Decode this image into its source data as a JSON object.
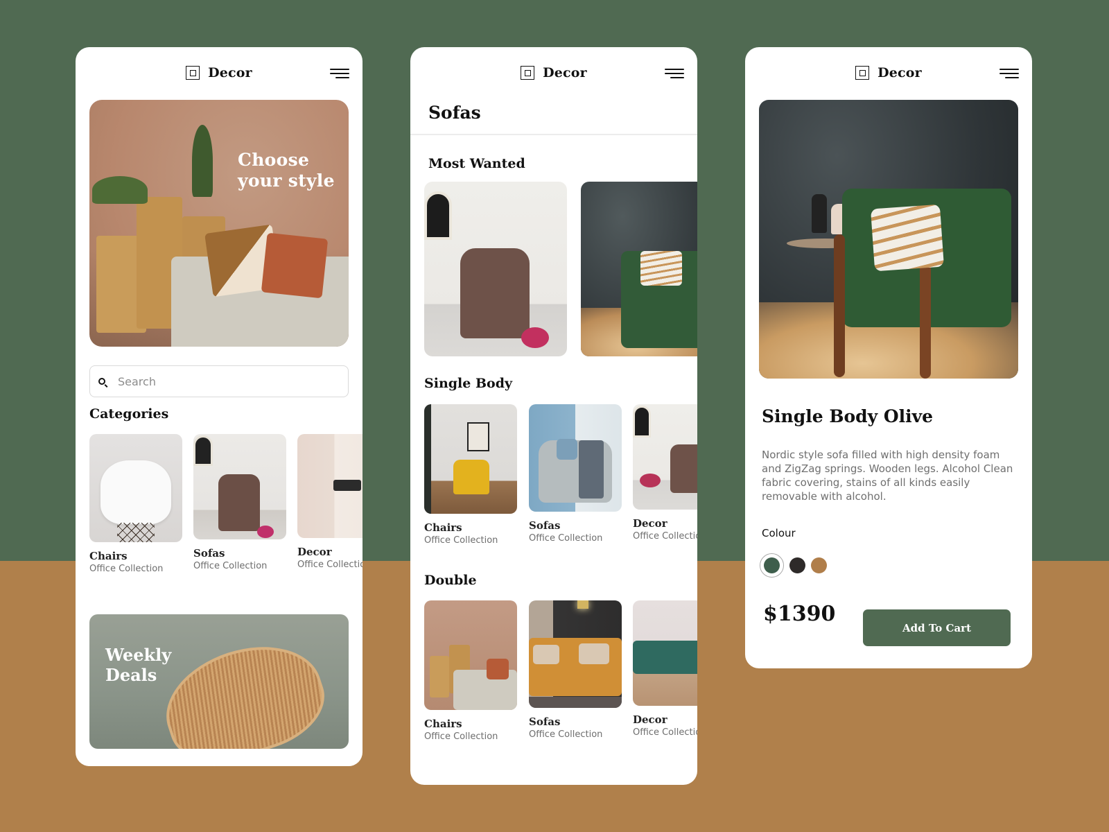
{
  "theme": {
    "background_top": "#506a52",
    "background_bottom": "#b0804b",
    "accent": "#506a52"
  },
  "brand": {
    "name": "Decor",
    "logo_icon": "square-logo-icon",
    "menu_icon": "hamburger-menu-icon"
  },
  "home": {
    "hero_text_line1": "Choose",
    "hero_text_line2": "your style",
    "search_placeholder": "Search",
    "search_value": "",
    "categories_title": "Categories",
    "categories": [
      {
        "title": "Chairs",
        "subtitle": "Office Collection"
      },
      {
        "title": "Sofas",
        "subtitle": "Office Collection"
      },
      {
        "title": "Decor",
        "subtitle": "Office Collection"
      }
    ],
    "deals_line1": "Weekly",
    "deals_line2": "Deals"
  },
  "listing": {
    "page_title": "Sofas",
    "sections": [
      {
        "title": "Most Wanted",
        "items": []
      },
      {
        "title": "Single Body",
        "items": [
          {
            "title": "Chairs",
            "subtitle": "Office Collection"
          },
          {
            "title": "Sofas",
            "subtitle": "Office Collection"
          },
          {
            "title": "Decor",
            "subtitle": "Office Collection"
          }
        ]
      },
      {
        "title": "Double",
        "items": [
          {
            "title": "Chairs",
            "subtitle": "Office Collection"
          },
          {
            "title": "Sofas",
            "subtitle": "Office Collection"
          },
          {
            "title": "Decor",
            "subtitle": "Office Collection"
          }
        ]
      }
    ]
  },
  "product": {
    "title": "Single Body Olive",
    "description": "Nordic style sofa filled with high density foam and ZigZag springs. Wooden legs. Alcohol Clean fabric covering, stains of all kinds easily removable with alcohol.",
    "colour_label": "Colour",
    "colours": [
      {
        "name": "green",
        "hex": "#3e5e4c",
        "selected": true
      },
      {
        "name": "charcoal",
        "hex": "#2e2a29",
        "selected": false
      },
      {
        "name": "tan",
        "hex": "#b07e4a",
        "selected": false
      }
    ],
    "price": "$1390",
    "add_to_cart_label": "Add To Cart"
  }
}
